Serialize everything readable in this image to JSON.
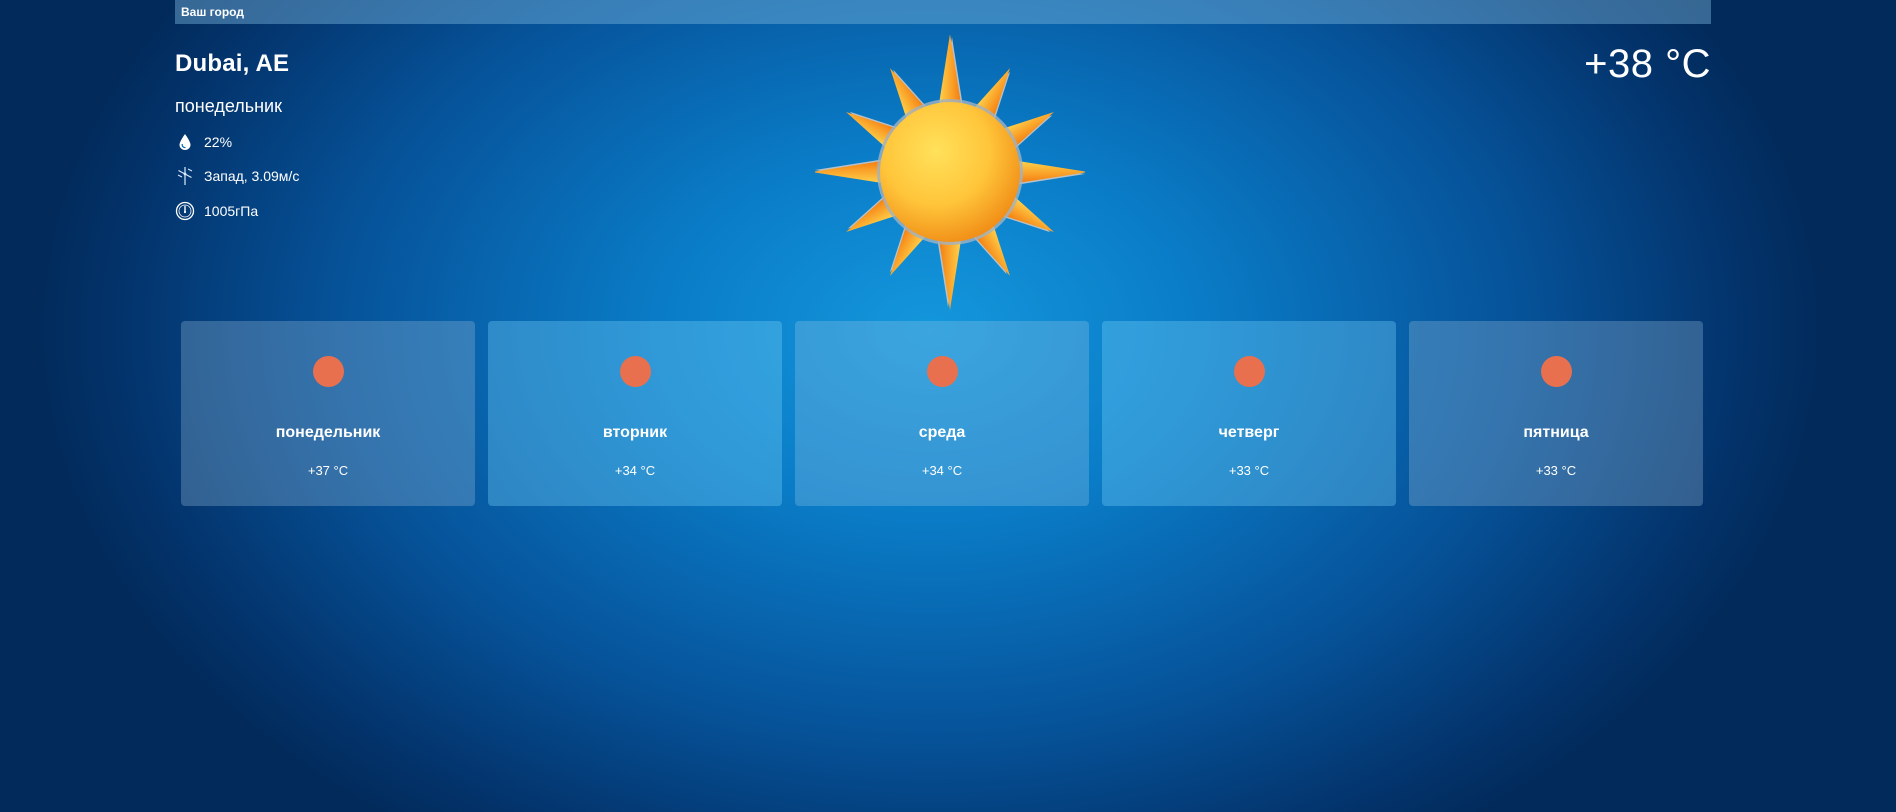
{
  "search": {
    "placeholder": "Ваш город"
  },
  "current": {
    "city": "Dubai, AE",
    "day": "понедельник",
    "humidity": "22%",
    "wind": "Запад, 3.09м/с",
    "pressure": "1005гПа",
    "temperature": "+38 °C",
    "icon": "sun-icon"
  },
  "forecast": [
    {
      "day": "понедельник",
      "temp": "+37 °C",
      "icon": "sun-dot-icon"
    },
    {
      "day": "вторник",
      "temp": "+34 °C",
      "icon": "sun-dot-icon"
    },
    {
      "day": "среда",
      "temp": "+34 °C",
      "icon": "sun-dot-icon"
    },
    {
      "day": "четверг",
      "temp": "+33 °C",
      "icon": "sun-dot-icon"
    },
    {
      "day": "пятница",
      "temp": "+33 °C",
      "icon": "sun-dot-icon"
    }
  ],
  "colors": {
    "background": "#0a7cc7",
    "forecast_dot": "#e8704f",
    "sun_core": "#ffc53a",
    "sun_ray": "#f59a1e"
  }
}
